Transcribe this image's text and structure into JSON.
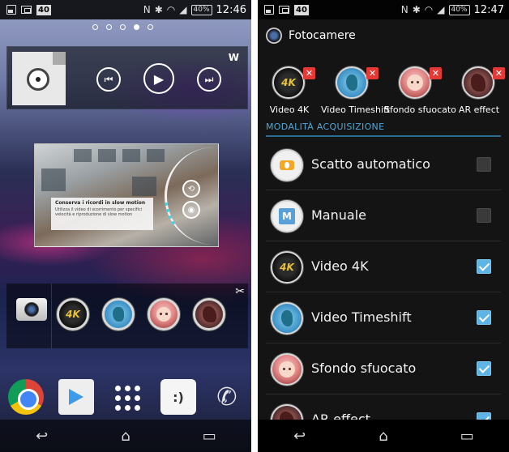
{
  "left": {
    "statusbar": {
      "badge": "40",
      "battery": "40%",
      "time": "12:46"
    },
    "pager": {
      "total": 5,
      "active": 4
    },
    "music": {
      "brand": "W",
      "prev": "⏮",
      "play": "▶",
      "next": "⏭"
    },
    "preview": {
      "card_title": "Conserva i ricordi in slow motion",
      "card_text": "Utilizza il video di scorrimento per specifici velocità e riproduzione di slow motion"
    },
    "camera_widget": {
      "tools": "✂",
      "modes": [
        "4K"
      ]
    },
    "navbar": {
      "back": "↩",
      "home": "⌂",
      "recents": "▭"
    }
  },
  "right": {
    "statusbar": {
      "badge": "40",
      "battery": "40%",
      "time": "12:47"
    },
    "appbar": {
      "title": "Fotocamere"
    },
    "chips": [
      {
        "label": "Video 4K",
        "x": "✕"
      },
      {
        "label": "Video Timeshift",
        "x": "✕"
      },
      {
        "label": "Sfondo sfuocato",
        "x": "✕"
      },
      {
        "label": "AR effect",
        "x": "✕"
      }
    ],
    "chip_4k": "4K",
    "section_header": "MODALITÀ ACQUISIZIONE",
    "list": [
      {
        "label": "Scatto automatico",
        "checked": false
      },
      {
        "label": "Manuale",
        "checked": false,
        "icon_letter": "M"
      },
      {
        "label": "Video 4K",
        "checked": true
      },
      {
        "label": "Video Timeshift",
        "checked": true
      },
      {
        "label": "Sfondo sfuocato",
        "checked": true
      },
      {
        "label": "AR effect",
        "checked": true
      }
    ],
    "navbar": {
      "back": "↩",
      "home": "⌂",
      "recents": "▭"
    }
  }
}
